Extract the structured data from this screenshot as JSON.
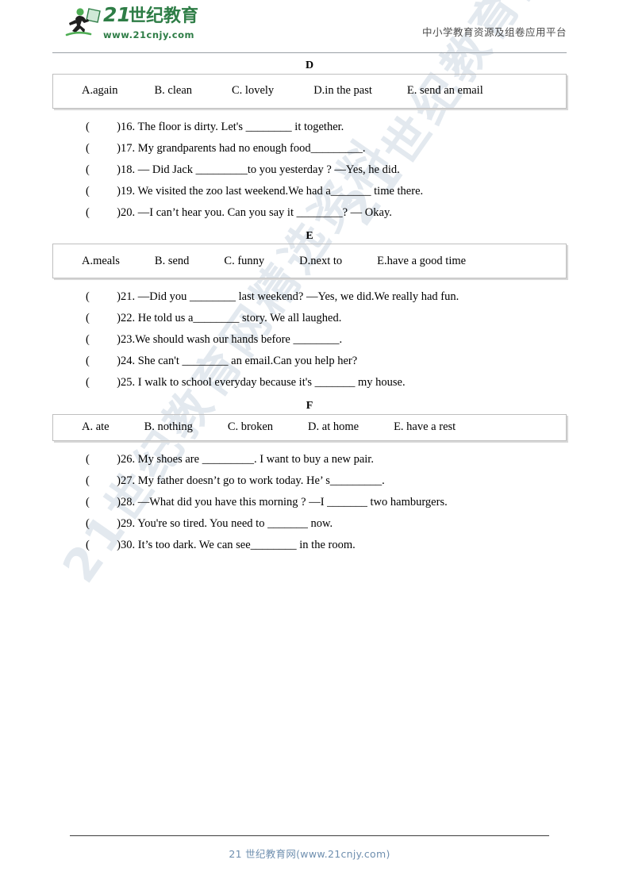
{
  "header": {
    "logo_number": "21",
    "logo_cn": "世纪教育",
    "logo_url": "www.21cnjy.com",
    "logo_icon": "runner-with-book-icon",
    "right_text": "中小学教育资源及组卷应用平台",
    "brand_green": "#2e7d46"
  },
  "watermark": {
    "text": "21世纪教育网精选资料",
    "color": "#e3e9ef"
  },
  "sections": [
    {
      "letter": "D",
      "options": [
        "A.again",
        "B. clean",
        "C. lovely",
        "D.in the past",
        "E. send an email"
      ],
      "questions": [
        "16. The floor is dirty. Let's ________ it together.",
        "17. My grandparents had no enough food_________.",
        "18. — Did Jack _________to you yesterday ?   —Yes, he did.",
        "19. We visited the zoo last weekend.We had a_______ time there.",
        "20. —I can’t hear you. Can you say it ________?      — Okay."
      ]
    },
    {
      "letter": "E",
      "options": [
        "A.meals",
        "B. send",
        "C. funny",
        "D.next to",
        "E.have a good time"
      ],
      "questions": [
        "21. —Did you ________ last weekend?    —Yes, we did.We really had fun.",
        "22. He told us a________ story. We all laughed.",
        "23.We should wash our hands before ________.",
        "24. She can't ________ an email.Can you help her?",
        "25. I walk to school everyday because it's _______ my house."
      ]
    },
    {
      "letter": "F",
      "options": [
        "A.  ate",
        "B. nothing",
        "C. broken",
        "D. at home",
        "E. have a rest"
      ],
      "questions": [
        "26. My shoes are _________. I want to buy a new pair.",
        "27. My father doesn’t go to work today. He’ s_________.",
        "28. —What did you have this morning ?   —I _______ two hamburgers.",
        "29. You're so tired. You need to _______ now.",
        "30. It’s too dark. We can see________ in the room."
      ]
    }
  ],
  "footer": {
    "text": "21 世纪教育网(www.21cnjy.com)",
    "color": "#6f8faf"
  }
}
